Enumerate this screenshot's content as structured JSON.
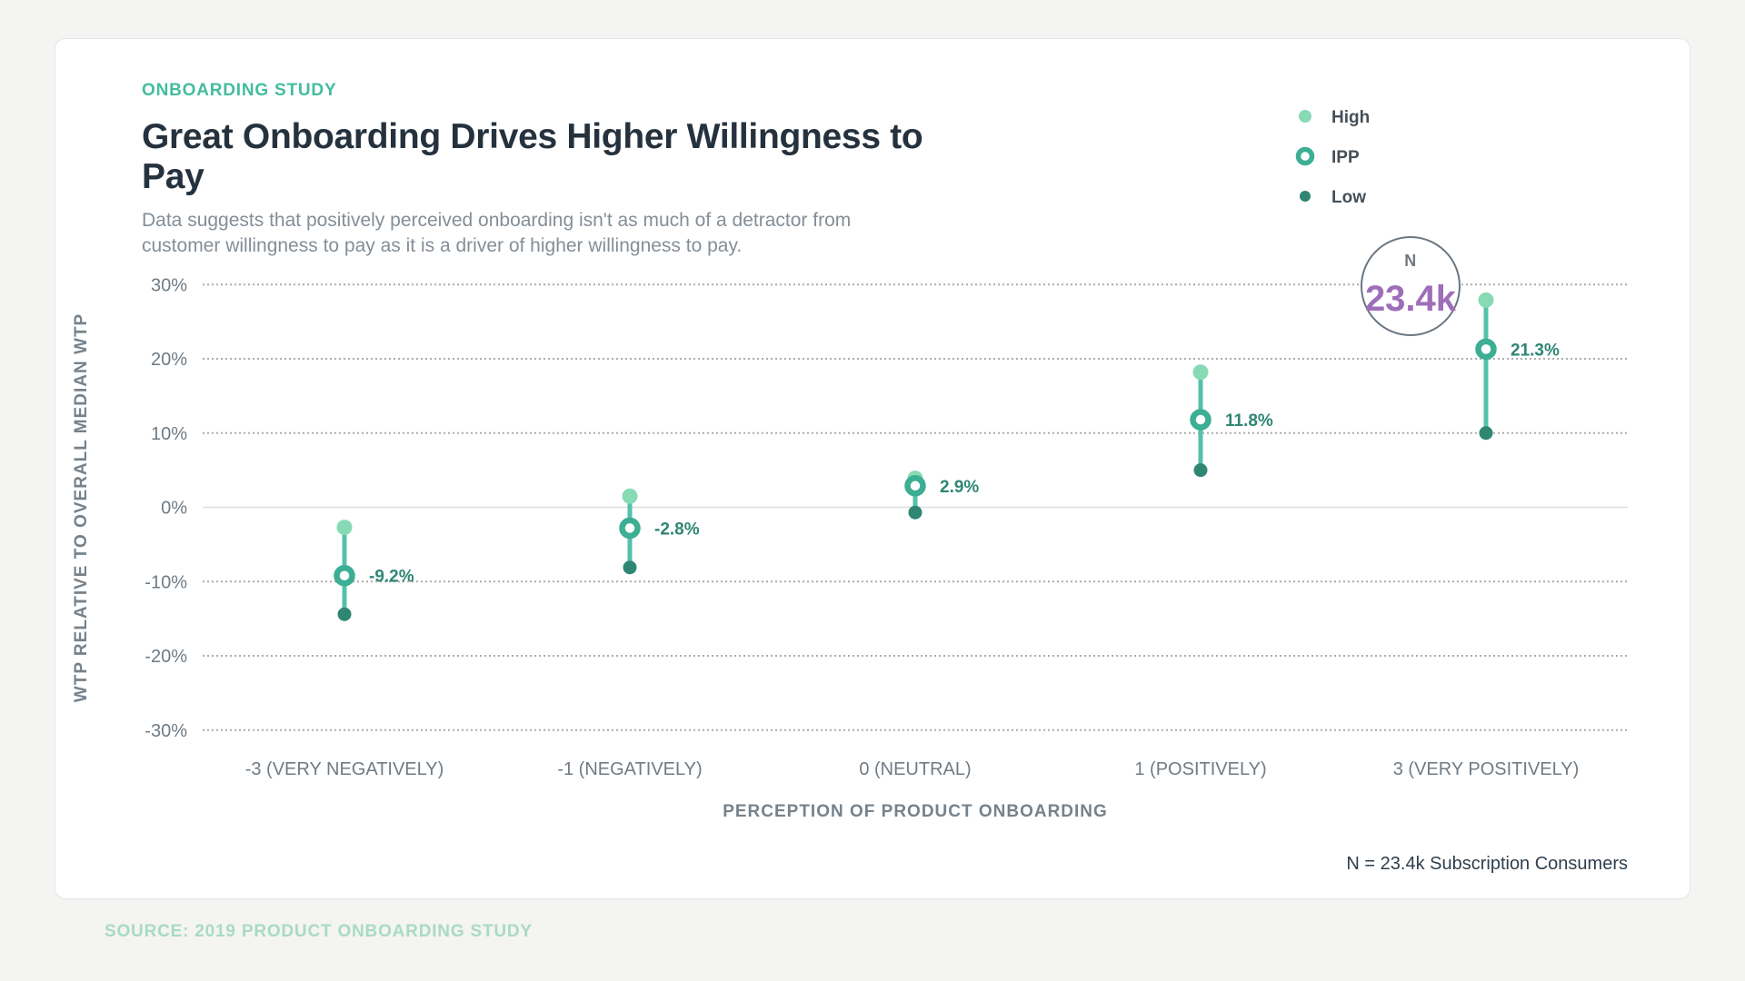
{
  "card": {
    "eyebrow": "ONBOARDING STUDY",
    "title": "Great Onboarding Drives Higher Willingness to Pay",
    "subtitle": "Data suggests that positively perceived onboarding isn't as much of a detractor from customer willingness to pay as it is a driver of higher willingness to pay.",
    "footnote": "N = 23.4k Subscription Consumers"
  },
  "source_note": "SOURCE: 2019 PRODUCT ONBOARDING STUDY",
  "chart_data": {
    "type": "scatter",
    "variant": "dot-range-plot",
    "title": "Great Onboarding Drives Higher Willingness to Pay",
    "xlabel": "PERCEPTION OF PRODUCT ONBOARDING",
    "ylabel": "WTP RELATIVE TO OVERALL MEDIAN WTP",
    "ylim": [
      -30,
      30
    ],
    "grid": "horizontal dotted lines, solid line at 0%",
    "legend_position": "top-right",
    "categories": [
      "-3 (VERY NEGATIVELY)",
      "-1 (NEGATIVELY)",
      "0 (NEUTRAL)",
      "1 (POSITIVELY)",
      "3 (VERY POSITIVELY)"
    ],
    "series": [
      {
        "name": "High",
        "values": [
          -2.7,
          1.5,
          3.9,
          18.2,
          27.9
        ]
      },
      {
        "name": "IPP",
        "values": [
          -9.2,
          -2.8,
          2.9,
          11.8,
          21.3
        ]
      },
      {
        "name": "Low",
        "values": [
          -14.4,
          -8.1,
          -0.7,
          5.0,
          10.0
        ]
      }
    ],
    "point_labels": [
      "-9.2%",
      "-2.8%",
      "2.9%",
      "11.8%",
      "21.3%"
    ],
    "yticks": [
      {
        "value": 30,
        "label": "30%"
      },
      {
        "value": 20,
        "label": "20%"
      },
      {
        "value": 10,
        "label": "10%"
      },
      {
        "value": 0,
        "label": "0%"
      },
      {
        "value": -10,
        "label": "-10%"
      },
      {
        "value": -20,
        "label": "-20%"
      },
      {
        "value": -30,
        "label": "-30%"
      }
    ],
    "legend": [
      {
        "label": "High",
        "style": "dot",
        "color": "#87DAB4"
      },
      {
        "label": "IPP",
        "style": "ring",
        "color": "#3CAE93"
      },
      {
        "label": "Low",
        "style": "dot-small",
        "color": "#2E8673"
      }
    ],
    "annotation": {
      "label": "N",
      "value": "23.4k"
    },
    "colors": {
      "high": "#87DAB4",
      "ipp_ring": "#3CAE93",
      "low": "#2E8673",
      "stem": "#54C1A9",
      "point_label": "#2E8673",
      "accent": "#43BD9E",
      "annotation_value": "#9F6EB9",
      "grid_dotted": "#ACACAC",
      "grid_zero": "#DADDDE",
      "annotation_stroke": "#6A7682"
    }
  }
}
